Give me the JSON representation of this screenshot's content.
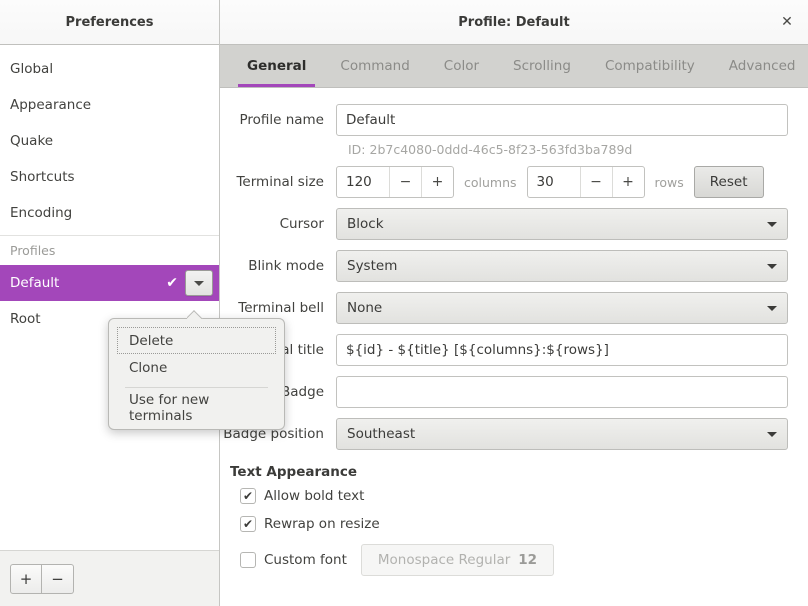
{
  "sidebar": {
    "header_title": "Preferences",
    "items": [
      {
        "label": "Global",
        "type": "nav"
      },
      {
        "label": "Appearance",
        "type": "nav"
      },
      {
        "label": "Quake",
        "type": "nav"
      },
      {
        "label": "Shortcuts",
        "type": "nav"
      },
      {
        "label": "Encoding",
        "type": "nav"
      }
    ],
    "section_label": "Profiles",
    "profiles": [
      {
        "label": "Default",
        "selected": true,
        "check": "✔",
        "dropdown_icon": "chevron-down-icon"
      },
      {
        "label": "Root",
        "selected": false
      }
    ],
    "footer": {
      "add_label": "+",
      "remove_label": "−"
    }
  },
  "popover": {
    "items": [
      {
        "label": "Delete",
        "focused": true
      },
      {
        "label": "Clone",
        "focused": false
      },
      {
        "label": "Use for new terminals",
        "focused": false
      }
    ]
  },
  "titlebar": {
    "title": "Profile: Default",
    "close_label": "✕"
  },
  "tabs": [
    {
      "label": "General",
      "active": true
    },
    {
      "label": "Command",
      "active": false
    },
    {
      "label": "Color",
      "active": false
    },
    {
      "label": "Scrolling",
      "active": false
    },
    {
      "label": "Compatibility",
      "active": false
    },
    {
      "label": "Advanced",
      "active": false
    }
  ],
  "form": {
    "profile_name": {
      "label": "Profile name",
      "value": "Default"
    },
    "id_line": "ID: 2b7c4080-0ddd-46c5-8f23-563fd3ba789d",
    "terminal_size": {
      "label": "Terminal size",
      "columns_value": "120",
      "columns_unit": "columns",
      "rows_value": "30",
      "rows_unit": "rows",
      "minus_label": "−",
      "plus_label": "+",
      "reset_label": "Reset"
    },
    "cursor": {
      "label": "Cursor",
      "value": "Block"
    },
    "blink_mode": {
      "label": "Blink mode",
      "value": "System"
    },
    "terminal_bell": {
      "label": "Terminal bell",
      "value": "None"
    },
    "terminal_title": {
      "label": "Terminal title",
      "value": "${id} - ${title} [${columns}:${rows}]"
    },
    "badge": {
      "label": "Badge",
      "value": ""
    },
    "badge_position": {
      "label": "Badge position",
      "value": "Southeast"
    },
    "text_appearance": {
      "heading": "Text Appearance",
      "allow_bold": {
        "label": "Allow bold text",
        "checked": true,
        "tick": "✔"
      },
      "rewrap": {
        "label": "Rewrap on resize",
        "checked": true,
        "tick": "✔"
      },
      "custom_font": {
        "label": "Custom font",
        "checked": false,
        "tick": ""
      },
      "font_name": "Monospace Regular",
      "font_size": "12"
    }
  },
  "colors": {
    "accent": "#a347ba",
    "header_bg": "#fbfbfb",
    "tabbar_bg": "#d2d2cf"
  }
}
